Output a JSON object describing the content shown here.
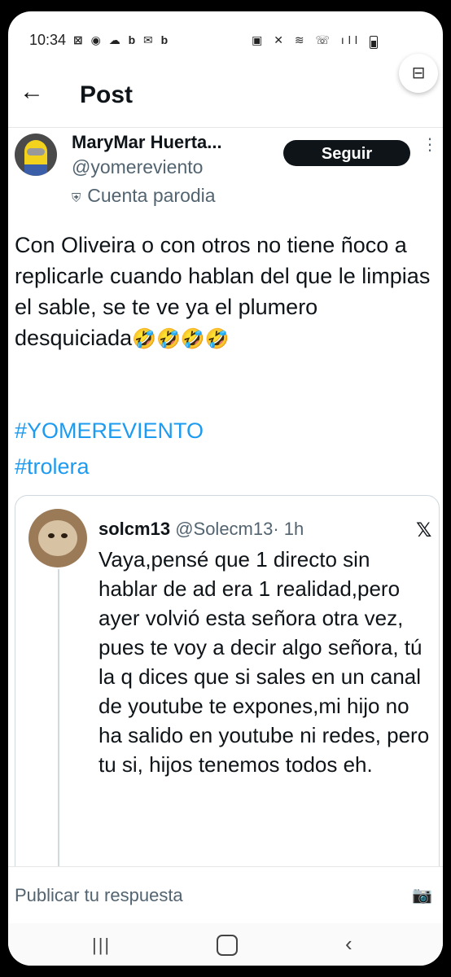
{
  "status_bar": {
    "time": "10:34",
    "left_icons": "⊠ ◉ ☁ b ✉ b",
    "right_icons": "▣ ✕ ≋ ☏ ıll"
  },
  "header": {
    "back_icon": "←",
    "title": "Post"
  },
  "author": {
    "name": "MaryMar Huerta...",
    "handle": "@yomereviento",
    "parody_icon": "⛨",
    "parody_label": "Cuenta parodia",
    "follow_label": "Seguir",
    "more_icon": "⋮"
  },
  "post": {
    "text": "Con Oliveira o con otros no tiene ñoco a replicarle cuando hablan del que le limpias el sable, se te ve ya el plumero desquiciada",
    "emojis": "🤣🤣🤣🤣",
    "hashtags": [
      "#YOMEREVIENTO",
      "#trolera"
    ]
  },
  "quoted_post": {
    "name": "solcm13",
    "handle": "@Solecm13",
    "time": "· 1h",
    "x_logo": "𝕏",
    "text": "Vaya,pensé que 1 directo sin hablar de ad era 1 realidad,pero ayer volvió esta señora otra vez, pues te voy a decir algo señora, tú la q dices que si sales en un canal de youtube te expones,mi hijo no ha salido en youtube ni redes, pero tu si, hijos tenemos todos eh."
  },
  "reply": {
    "placeholder": "Publicar tu respuesta",
    "camera_icon": "📷",
    "scan_icon": "⊟"
  },
  "navbar": {
    "recent": "|||",
    "back": "‹"
  },
  "colors": {
    "accent": "#1d9bf0",
    "text": "#0f1419",
    "muted": "#536471"
  }
}
